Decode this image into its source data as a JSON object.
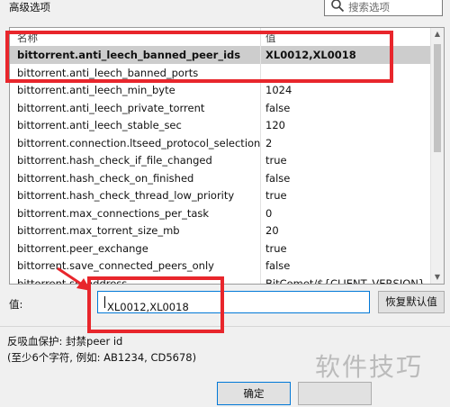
{
  "header": {
    "section_label": "高级选项",
    "search_placeholder": "搜索选项"
  },
  "table": {
    "columns": [
      "名称",
      "值"
    ],
    "rows": [
      {
        "name": "bittorrent.anti_leech_banned_peer_ids",
        "value": "XL0012,XL0018",
        "selected": true
      },
      {
        "name": "bittorrent.anti_leech_banned_ports",
        "value": ""
      },
      {
        "name": "bittorrent.anti_leech_min_byte",
        "value": "1024"
      },
      {
        "name": "bittorrent.anti_leech_private_torrent",
        "value": "false"
      },
      {
        "name": "bittorrent.anti_leech_stable_sec",
        "value": "120"
      },
      {
        "name": "bittorrent.connection.ltseed_protocol_selection",
        "value": "2"
      },
      {
        "name": "bittorrent.hash_check_if_file_changed",
        "value": "true"
      },
      {
        "name": "bittorrent.hash_check_on_finished",
        "value": "false"
      },
      {
        "name": "bittorrent.hash_check_thread_low_priority",
        "value": "true"
      },
      {
        "name": "bittorrent.max_connections_per_task",
        "value": "0"
      },
      {
        "name": "bittorrent.max_torrent_size_mb",
        "value": "20"
      },
      {
        "name": "bittorrent.peer_exchange",
        "value": "true"
      },
      {
        "name": "bittorrent.save_connected_peers_only",
        "value": "false"
      },
      {
        "name": "bittorrent.sp_address",
        "value": "BitComet/${CLIENT_VERSION}"
      }
    ]
  },
  "editor": {
    "label": "值:",
    "value": "XL0012,XL0018",
    "reset_label": "恢复默认值"
  },
  "description": {
    "line1": "反吸血保护: 封禁peer id",
    "line2": "(至少6个字符, 例如: AB1234, CD5678)"
  },
  "footer": {
    "ok_label": "确定"
  },
  "watermark": "软件技巧",
  "colors": {
    "highlight": "#e8262c",
    "focus": "#0078d7"
  }
}
